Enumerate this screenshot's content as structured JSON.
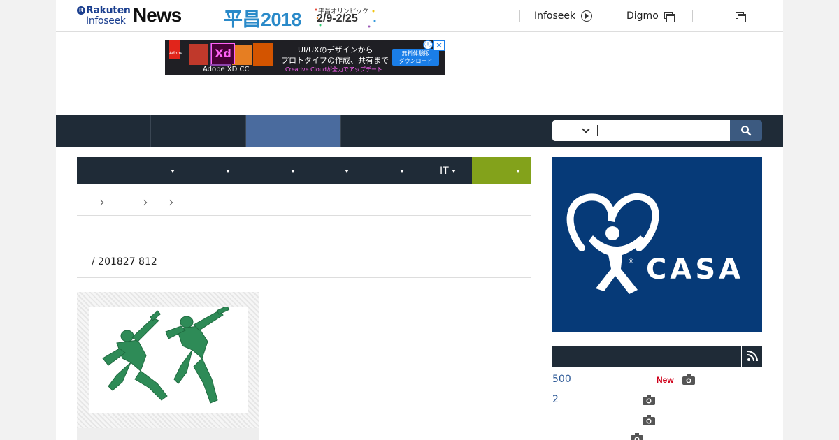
{
  "header": {
    "logo_top": "Rakuten",
    "logo_bottom": "Infoseek",
    "logo_news": "News",
    "logo_badge": "R",
    "promo_big": "平昌2018",
    "promo_small": "平昌オリンピック",
    "promo_dates": "2/9-2/25",
    "links": [
      {
        "label": "Infoseek",
        "icon": "circle-arrow-icon"
      },
      {
        "label": "Digmo",
        "icon": "window-icon"
      },
      {
        "label": "",
        "icon": "window-icon"
      }
    ]
  },
  "ad": {
    "brand": "Adobe",
    "product_badge": "Xd",
    "product": "Adobe XD CC",
    "line1": "UI/UXのデザインから",
    "line2": "プロトタイプの作成、共有まで",
    "line3": "Creative Cloudが全力でアップデート",
    "cta_line1": "無料体験版",
    "cta_line2": "ダウンロード",
    "info": "ⓘ",
    "close": "✕"
  },
  "search": {
    "placeholder": "",
    "value": ""
  },
  "subnav": {
    "it_label": "IT"
  },
  "article": {
    "meta": "/ 201827 812"
  },
  "sidebar": {
    "ad_brand": "CASA",
    "ad_reg": "®",
    "ranking": [
      {
        "label": "500",
        "new": "New"
      },
      {
        "label": "2",
        "new": ""
      },
      {
        "label": "",
        "new": ""
      },
      {
        "label": "",
        "new": ""
      }
    ]
  },
  "colors": {
    "nav_dark": "#1f2b37",
    "nav_active": "#4a6b9e",
    "subnav_green": "#83a21b",
    "casa_blue": "#063a78",
    "link_blue": "#2c5896",
    "new_red": "#d0021b"
  }
}
